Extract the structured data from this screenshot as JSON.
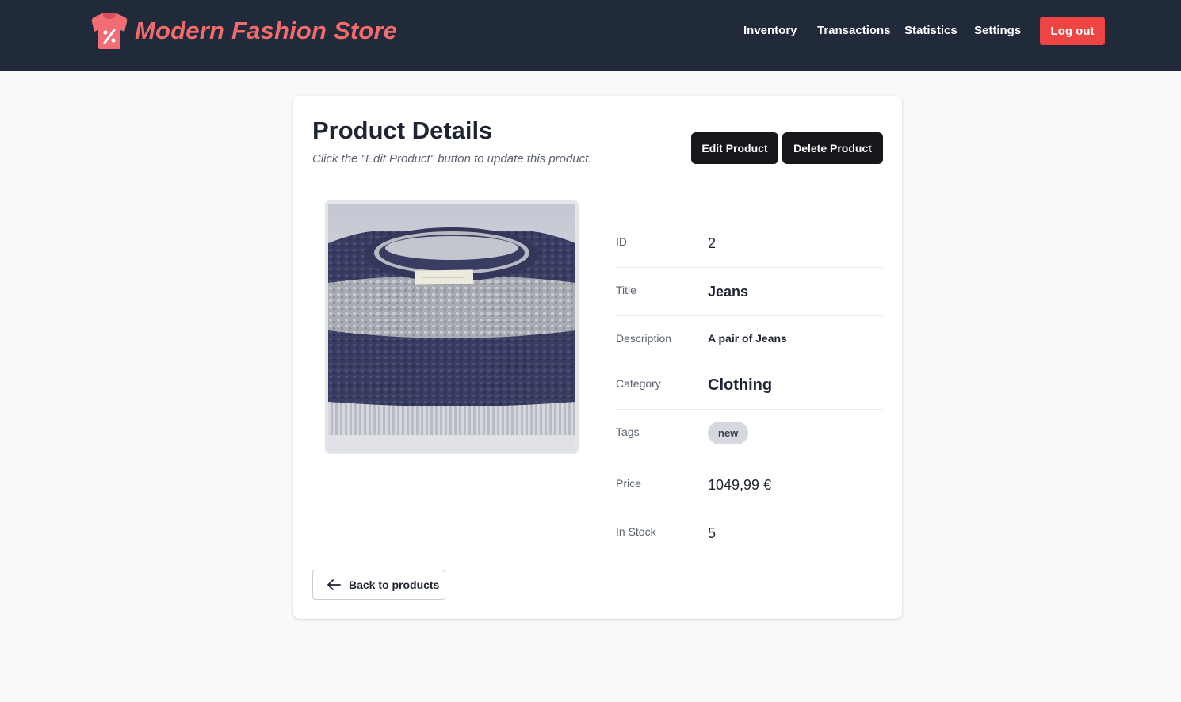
{
  "header": {
    "brand": "Modern Fashion Store",
    "nav": [
      {
        "label": "Inventory"
      },
      {
        "label": "Transactions"
      },
      {
        "label": "Statistics"
      },
      {
        "label": "Settings"
      }
    ],
    "logout_label": "Log out"
  },
  "product_page": {
    "title": "Product Details",
    "subtitle": "Click the \"Edit Product\" button to update this product.",
    "edit_label": "Edit Product",
    "delete_label": "Delete Product",
    "back_label": "Back to products",
    "image_icon": "striped-sweater-photo",
    "fields": {
      "id": {
        "label": "ID",
        "value": "2"
      },
      "title": {
        "label": "Title",
        "value": "Jeans"
      },
      "description": {
        "label": "Description",
        "value": "A pair of Jeans"
      },
      "category": {
        "label": "Category",
        "value": "Clothing"
      },
      "tags": {
        "label": "Tags",
        "values": [
          "new"
        ]
      },
      "price": {
        "label": "Price",
        "value": "1049,99 €"
      },
      "stock": {
        "label": "In Stock",
        "value": "5"
      }
    }
  },
  "colors": {
    "navbar": "#202a3a",
    "brand": "#f36b6b",
    "logout": "#ef4444",
    "primary_button": "#16171b"
  }
}
